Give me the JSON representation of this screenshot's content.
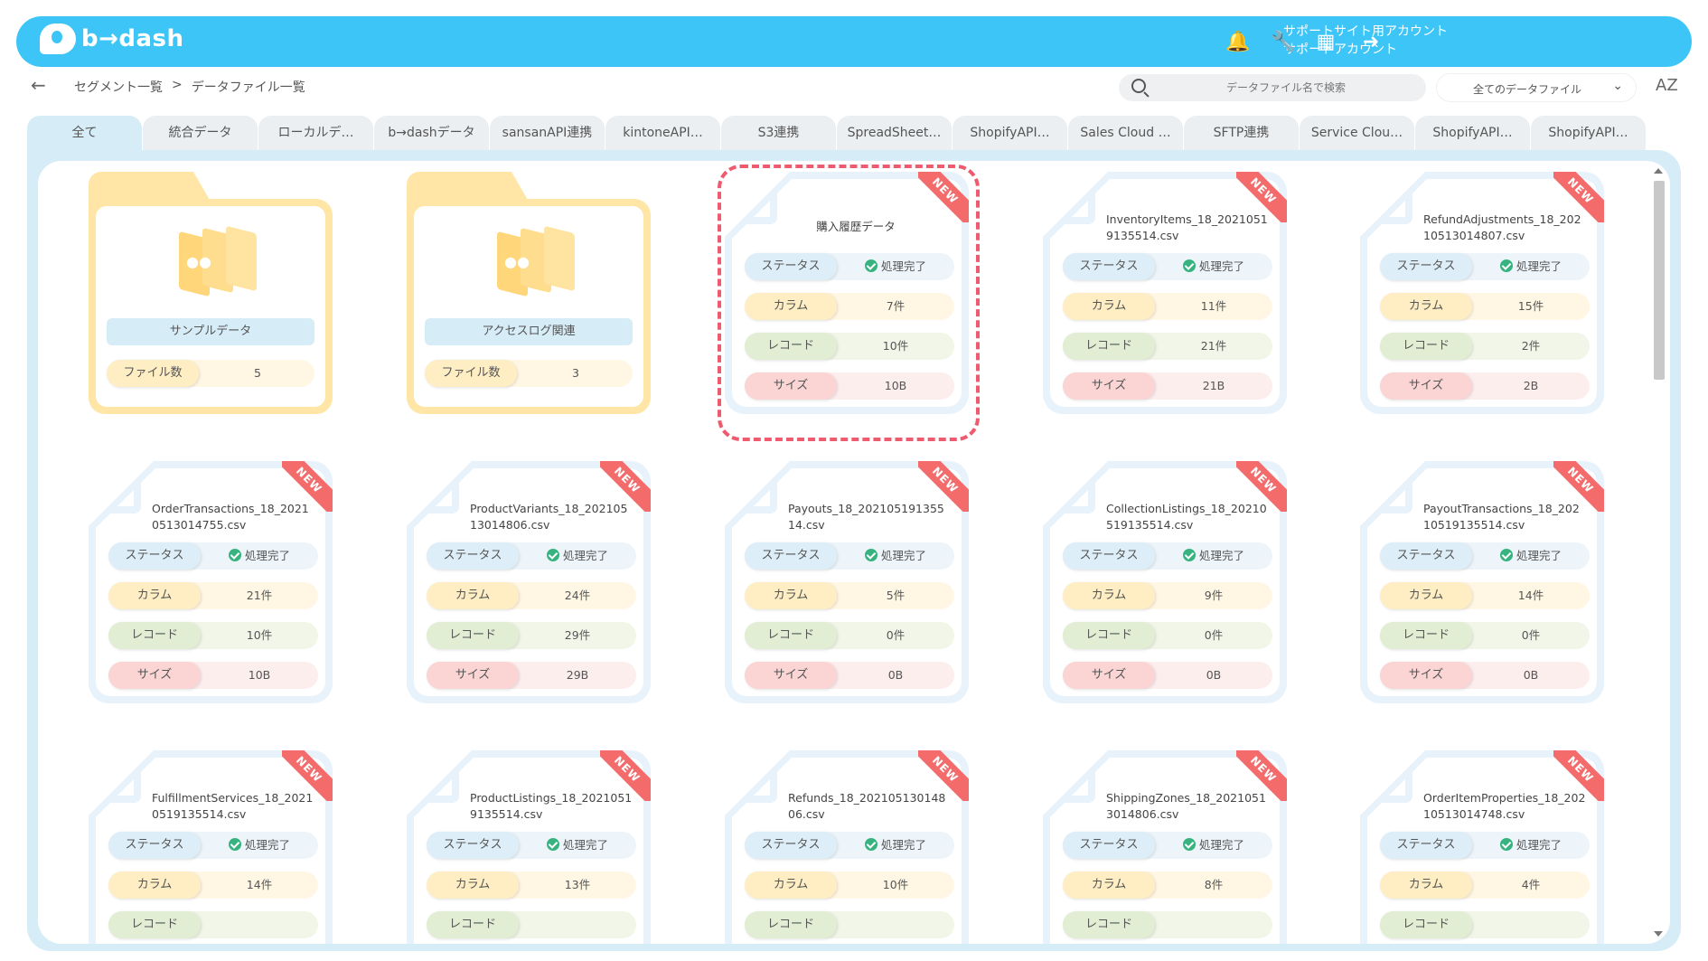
{
  "header": {
    "logo_text": "b→dash",
    "account_line1": "サポートサイト用アカウント",
    "account_line2": "サポートアカウント"
  },
  "subbar": {
    "breadcrumb": [
      "セグメント一覧",
      ">",
      "データファイル一覧"
    ],
    "search_placeholder": "データファイル名で検索",
    "filter_value": "全てのデータファイル",
    "sort_label": "AZ"
  },
  "tabs": [
    "全て",
    "統合データ",
    "ローカルデ…",
    "b→dashデータ",
    "sansanAPI連携",
    "kintoneAPI…",
    "S3連携",
    "SpreadSheet…",
    "ShopifyAPI…",
    "Sales Cloud …",
    "SFTP連携",
    "Service Clou…",
    "ShopifyAPI…",
    "ShopifyAPI…"
  ],
  "labels": {
    "status": "ステータス",
    "columns": "カラム",
    "records": "レコード",
    "size": "サイズ",
    "file_count": "ファイル数",
    "new_badge": "NEW"
  },
  "folders": [
    {
      "name": "サンプルデータ",
      "count": "5"
    },
    {
      "name": "アクセスログ関連",
      "count": "3"
    }
  ],
  "files": [
    {
      "title": "購入履歴データ",
      "status": "処理完了",
      "columns": "7件",
      "records": "10件",
      "size": "10B"
    },
    {
      "title": "InventoryItems_18_20210519135514.csv",
      "status": "処理完了",
      "columns": "11件",
      "records": "21件",
      "size": "21B"
    },
    {
      "title": "RefundAdjustments_18_20210513014807.csv",
      "status": "処理完了",
      "columns": "15件",
      "records": "2件",
      "size": "2B"
    },
    {
      "title": "OrderTransactions_18_20210513014755.csv",
      "status": "処理完了",
      "columns": "21件",
      "records": "10件",
      "size": "10B"
    },
    {
      "title": "ProductVariants_18_20210513014806.csv",
      "status": "処理完了",
      "columns": "24件",
      "records": "29件",
      "size": "29B"
    },
    {
      "title": "Payouts_18_20210519135514.csv",
      "status": "処理完了",
      "columns": "5件",
      "records": "0件",
      "size": "0B"
    },
    {
      "title": "CollectionListings_18_20210519135514.csv",
      "status": "処理完了",
      "columns": "9件",
      "records": "0件",
      "size": "0B"
    },
    {
      "title": "PayoutTransactions_18_20210519135514.csv",
      "status": "処理完了",
      "columns": "14件",
      "records": "0件",
      "size": "0B"
    },
    {
      "title": "FulfillmentServices_18_20210519135514.csv",
      "status": "処理完了",
      "columns": "14件",
      "records": "",
      "size": ""
    },
    {
      "title": "ProductListings_18_20210519135514.csv",
      "status": "処理完了",
      "columns": "13件",
      "records": "",
      "size": ""
    },
    {
      "title": "Refunds_18_20210513014806.csv",
      "status": "処理完了",
      "columns": "10件",
      "records": "",
      "size": ""
    },
    {
      "title": "ShippingZones_18_20210513014806.csv",
      "status": "処理完了",
      "columns": "8件",
      "records": "",
      "size": ""
    },
    {
      "title": "OrderItemProperties_18_20210513014748.csv",
      "status": "処理完了",
      "columns": "4件",
      "records": "",
      "size": ""
    }
  ],
  "colors": {
    "brand": "#3ec5f7",
    "panel": "#d6ecf7",
    "folder": "#ffe6a6",
    "new_badge": "#f36b6b",
    "selected_outline": "#ee5a6e",
    "status_ok": "#36b37e"
  }
}
